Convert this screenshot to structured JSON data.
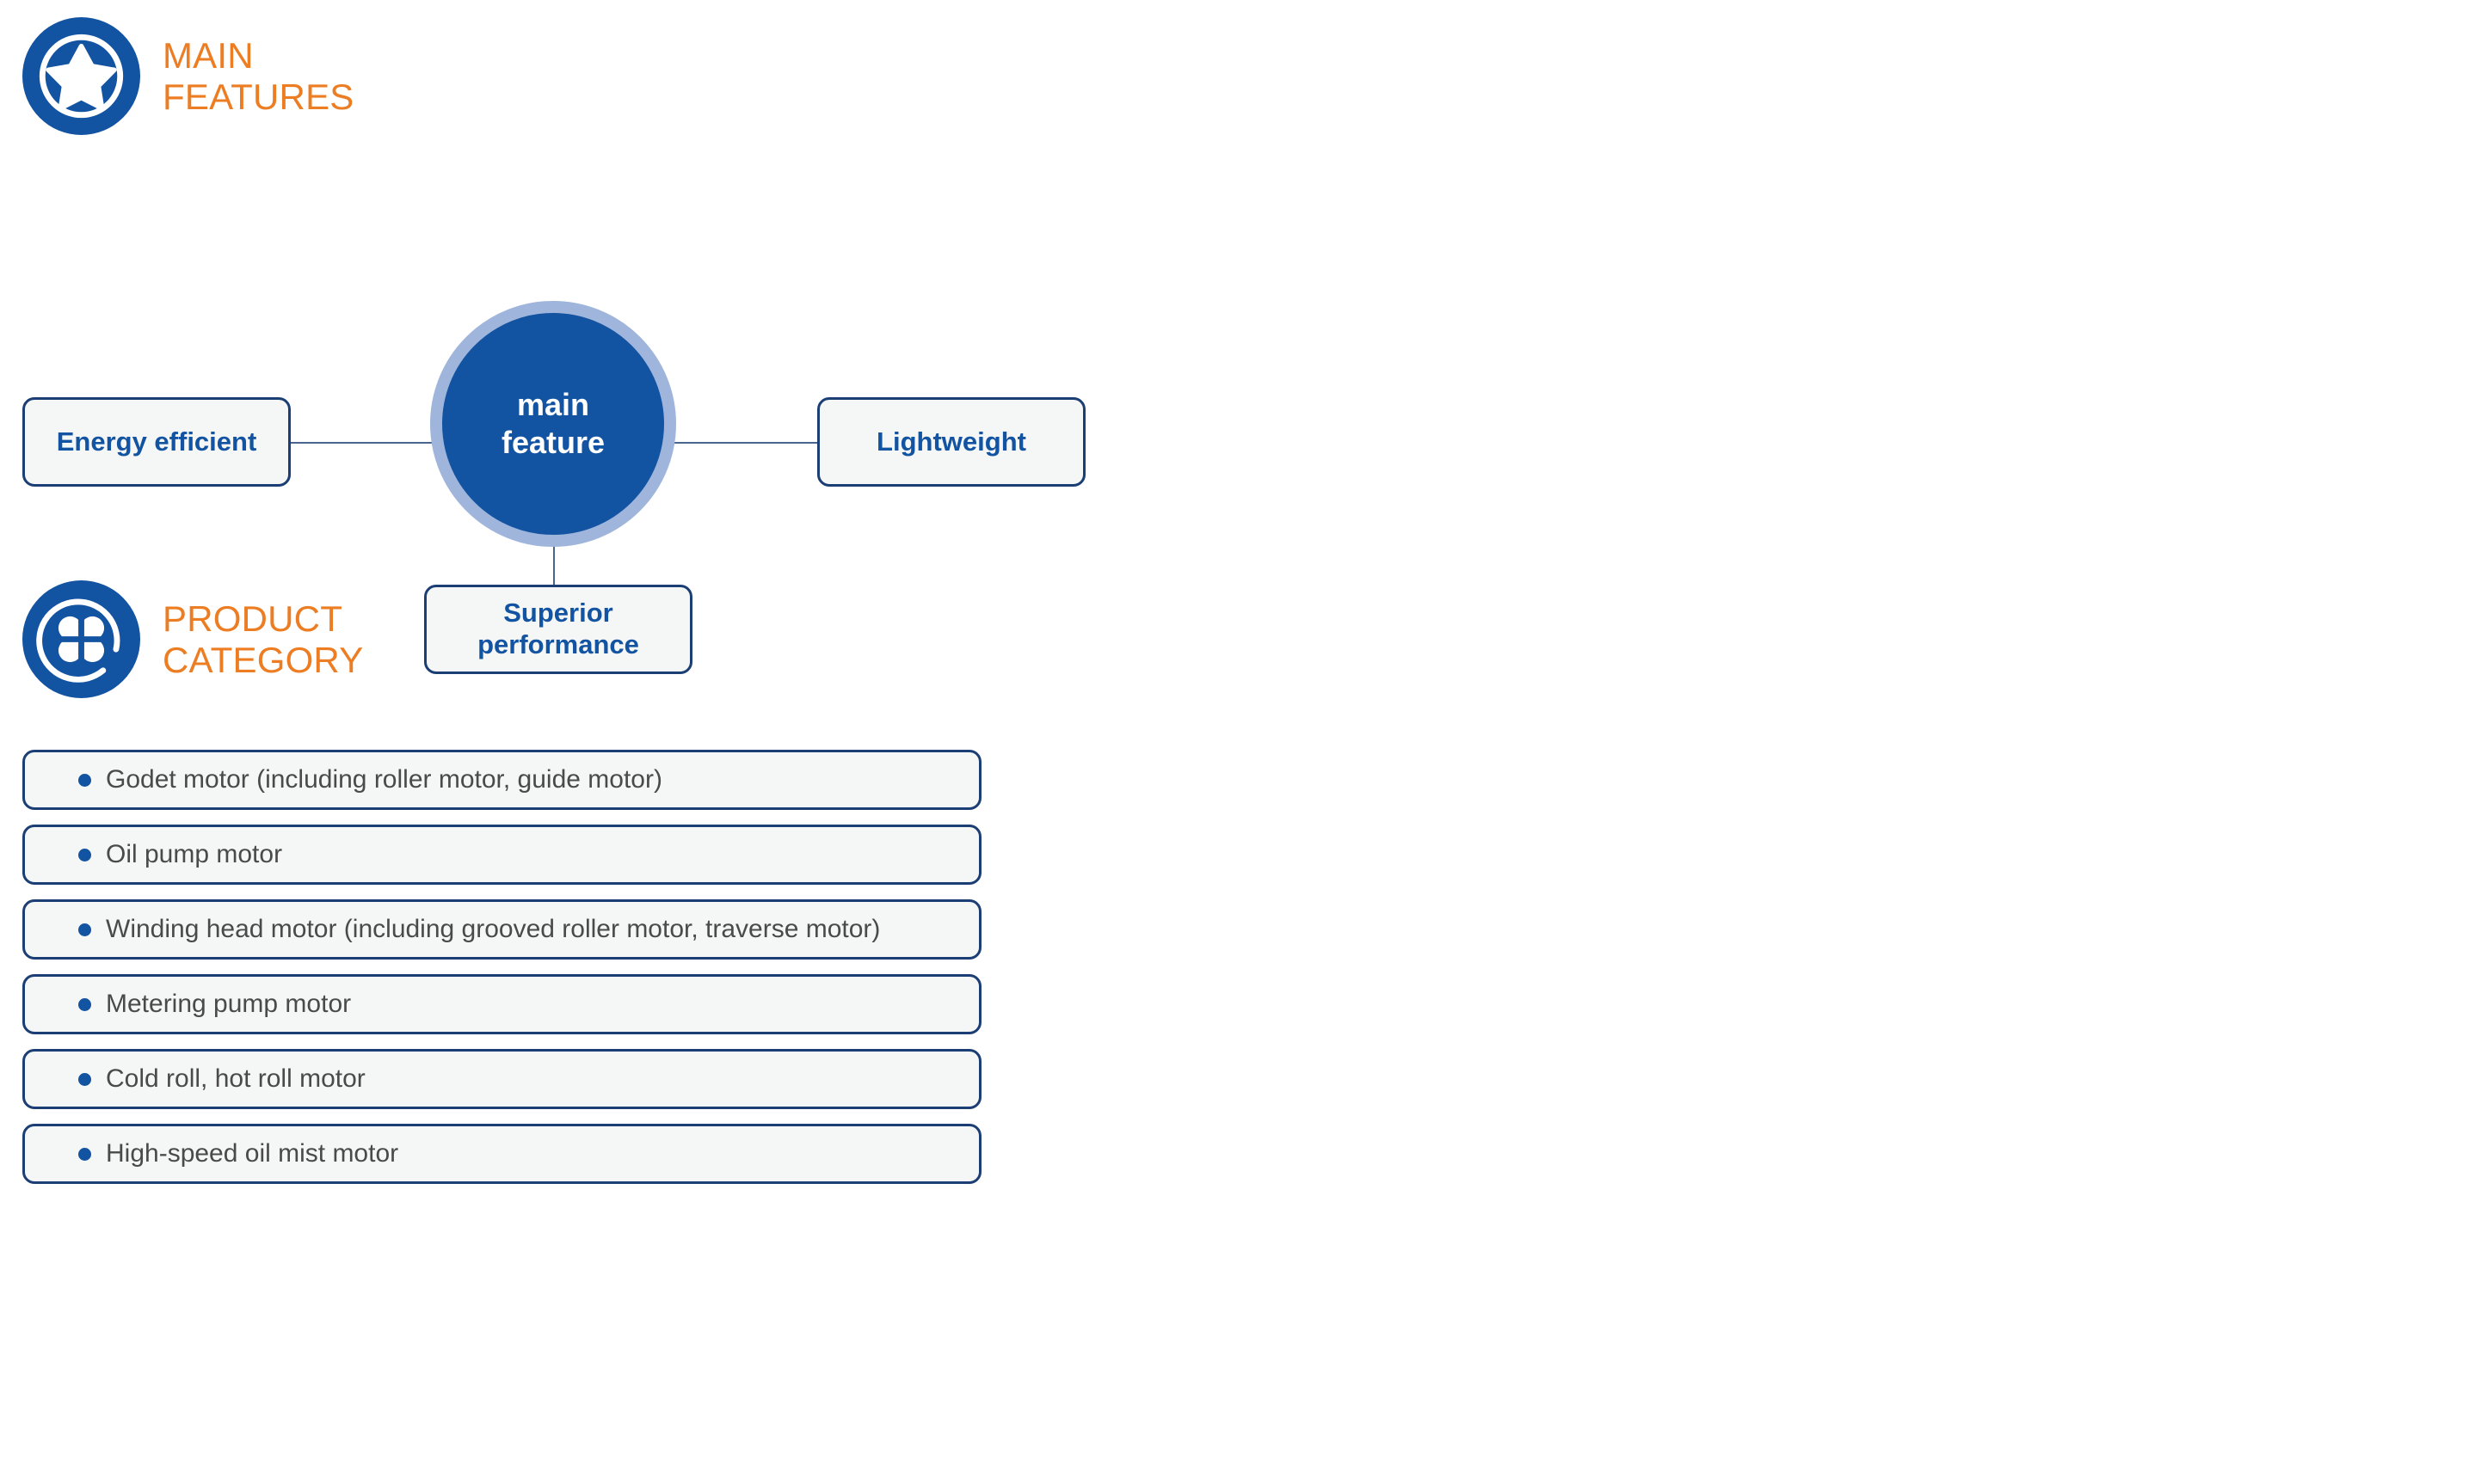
{
  "colors": {
    "brand_blue": "#1253A2",
    "dark_navy_border": "#1B3E74",
    "light_blue_ring": "#9FB5DB",
    "accent_orange": "#ED7D23",
    "node_background": "#F5F6F6",
    "connector_line": "#4A6490",
    "body_text": "#4A4A4A",
    "page_background": "#FFFFFF"
  },
  "sections": {
    "main_features": {
      "title": "MAIN\nFEATURES",
      "icon": "star-in-circle-icon"
    },
    "product_category": {
      "title": "PRODUCT\nCATEGORY",
      "icon": "clover-in-circle-icon"
    }
  },
  "mindmap": {
    "center": {
      "label": "main\nfeature"
    },
    "nodes": [
      {
        "id": "energy",
        "label": "Energy efficient",
        "position": "left"
      },
      {
        "id": "lightweight",
        "label": "Lightweight",
        "position": "right"
      },
      {
        "id": "superior",
        "label": "Superior\nperformance",
        "position": "bottom"
      }
    ]
  },
  "category_list": {
    "items": [
      {
        "label": "Godet motor (including roller motor, guide motor)"
      },
      {
        "label": "Oil pump motor"
      },
      {
        "label": "Winding head motor (including grooved roller motor, traverse motor)"
      },
      {
        "label": "Metering pump motor"
      },
      {
        "label": "Cold roll, hot roll motor"
      },
      {
        "label": "High-speed oil mist motor"
      }
    ]
  }
}
